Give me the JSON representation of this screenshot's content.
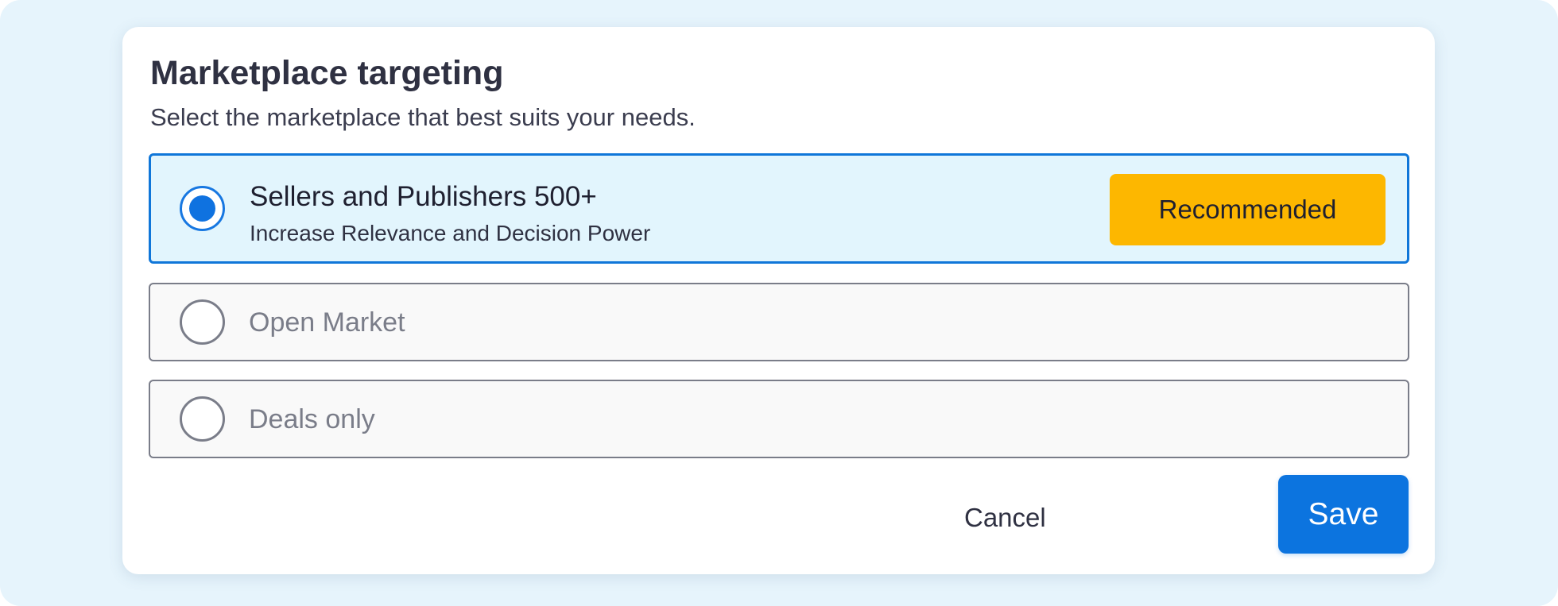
{
  "dialog": {
    "title": "Marketplace targeting",
    "subtitle": "Select the marketplace that best suits your needs."
  },
  "options": [
    {
      "label": "Sellers and Publishers 500+",
      "description": "Increase Relevance and Decision Power",
      "badge": "Recommended",
      "selected": true
    },
    {
      "label": "Open Market",
      "selected": false
    },
    {
      "label": "Deals only",
      "selected": false
    }
  ],
  "actions": {
    "cancel_label": "Cancel",
    "save_label": "Save"
  },
  "colors": {
    "accent": "#0c74df",
    "badge": "#fdb700",
    "selected_bg": "#e2f5fd",
    "backdrop": "#e6f4fc"
  }
}
